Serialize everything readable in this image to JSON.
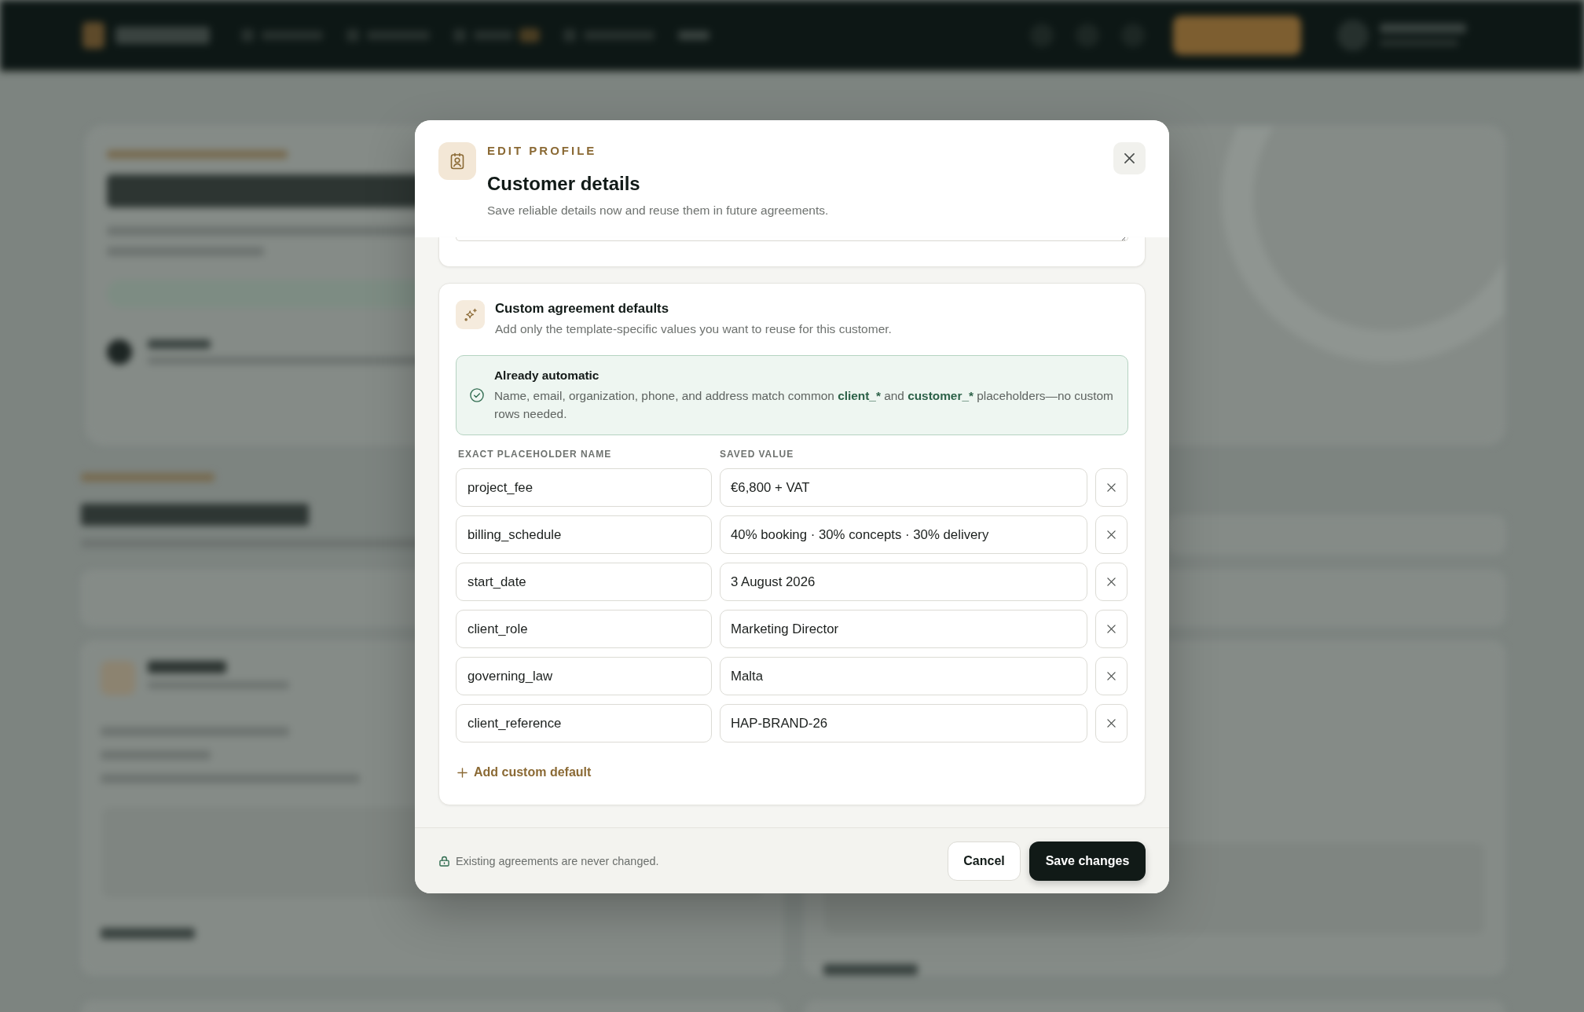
{
  "dialog": {
    "eyebrow": "EDIT PROFILE",
    "title": "Customer details",
    "subtitle": "Save reliable details now and reuse them in future agreements."
  },
  "defaults_card": {
    "title": "Custom agreement defaults",
    "subtitle": "Add only the template-specific values you want to reuse for this customer.",
    "notice": {
      "title": "Already automatic",
      "text": [
        {
          "text": "Name, email, organization, phone, and address match common ",
          "highlight": false
        },
        {
          "text": "client_*",
          "highlight": true
        },
        {
          "text": " and ",
          "highlight": false
        },
        {
          "text": "customer_*",
          "highlight": true
        },
        {
          "text": " placeholders—no custom rows needed.",
          "highlight": false
        }
      ]
    },
    "columns": [
      "EXACT PLACEHOLDER NAME",
      "SAVED VALUE"
    ],
    "rows": [
      {
        "name": "project_fee",
        "value": "€6,800 + VAT"
      },
      {
        "name": "billing_schedule",
        "value": "40% booking · 30% concepts · 30% delivery"
      },
      {
        "name": "start_date",
        "value": "3 August 2026"
      },
      {
        "name": "client_role",
        "value": "Marketing Director"
      },
      {
        "name": "governing_law",
        "value": "Malta"
      },
      {
        "name": "client_reference",
        "value": "HAP-BRAND-26"
      }
    ],
    "add_button": "Add custom default"
  },
  "footer": {
    "note": "Existing agreements are never changed.",
    "buttons": [
      {
        "label": "Cancel",
        "kind": "secondary"
      },
      {
        "label": "Save changes",
        "kind": "primary"
      }
    ]
  }
}
